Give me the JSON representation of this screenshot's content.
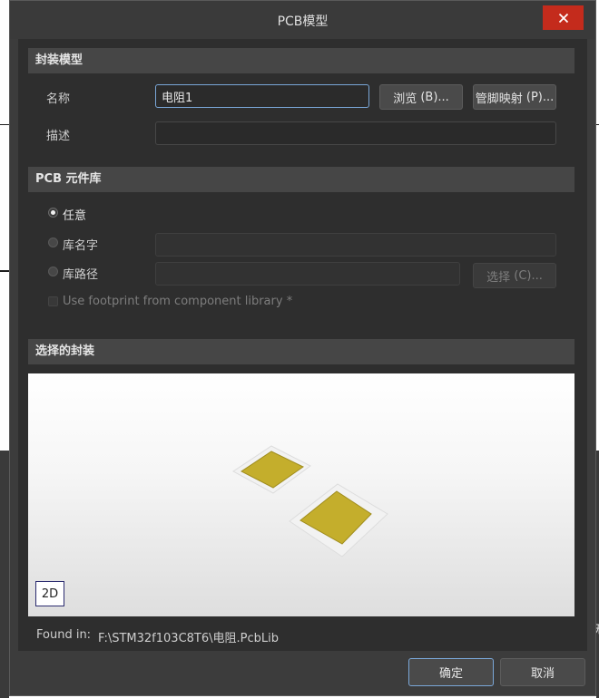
{
  "dialog": {
    "title": "PCB模型",
    "close_glyph": "✕"
  },
  "footprint_model": {
    "header": "封装模型",
    "name_label": "名称",
    "name_value": "电阻1",
    "browse_label": "浏览",
    "browse_key": "(B)...",
    "pinmap_label": "管脚映射",
    "pinmap_key": "(P)...",
    "desc_label": "描述",
    "desc_value": ""
  },
  "pcb_library": {
    "header": "PCB 元件库",
    "option_any": "任意",
    "option_lib_name": "库名字",
    "option_lib_path": "库路径",
    "select_label": "选择",
    "select_key": "(C)...",
    "use_footprint_label": "Use footprint from component library *",
    "selected_option": "任意"
  },
  "selected_footprint": {
    "header": "选择的封装",
    "view_mode_button": "2D",
    "found_in_label": "Found in:",
    "found_in_path": "F:\\STM32f103C8T6\\电阻.PcbLib"
  },
  "footer": {
    "ok_label": "确定",
    "cancel_label": "取消"
  },
  "colors": {
    "pad": "#c4ae2c",
    "pad_edge": "#a08d1e",
    "accent": "#7aa7d8",
    "close_red": "#c42b1c"
  },
  "background_app": {
    "edge_glyph": "无"
  }
}
